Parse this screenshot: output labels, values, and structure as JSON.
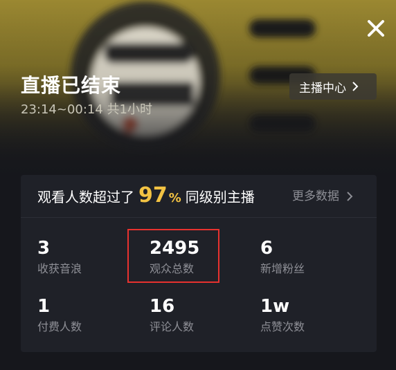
{
  "header": {
    "title": "直播已结束",
    "duration": "23:14~00:14 共1小时",
    "anchor_center_label": "主播中心"
  },
  "summary": {
    "prefix": "观看人数超过了",
    "percent_value": "97",
    "percent_sign": "%",
    "suffix": "同级别主播",
    "more_data_label": "更多数据"
  },
  "stats": [
    {
      "value": "3",
      "label": "收获音浪"
    },
    {
      "value": "2495",
      "label": "观众总数"
    },
    {
      "value": "6",
      "label": "新增粉丝"
    },
    {
      "value": "1",
      "label": "付费人数"
    },
    {
      "value": "16",
      "label": "评论人数"
    },
    {
      "value": "1w",
      "label": "点赞次数"
    }
  ],
  "highlighted_stat": "观众总数",
  "colors": {
    "accent": "#f3c343",
    "highlight_border": "#e8322f",
    "card_bg": "#1f2128",
    "page_bg": "#16171c"
  },
  "icons": {
    "close": "close-icon",
    "anchor_chevron": "chevron-right-icon",
    "more_chevron": "chevron-right-icon"
  }
}
